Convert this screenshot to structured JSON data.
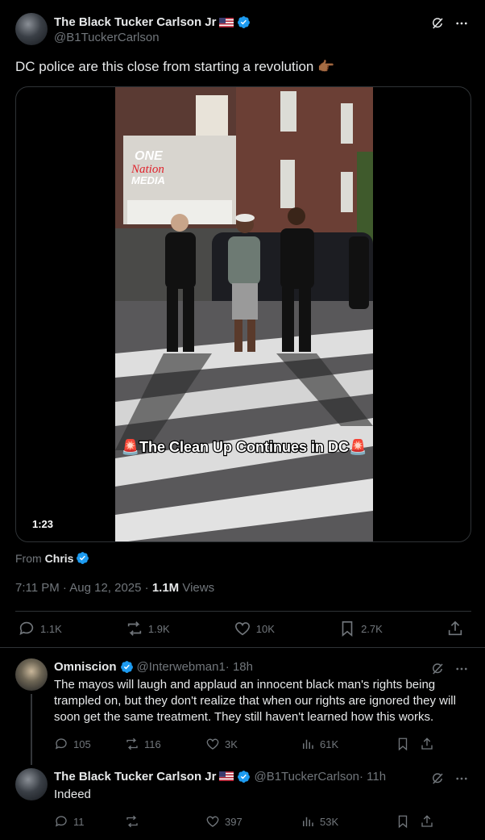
{
  "main_tweet": {
    "author_name": "The Black Tucker Carlson Jr",
    "handle": "@B1TuckerCarlson",
    "text": "DC police are this close from starting a revolution 👉🏾",
    "video_caption": "🚨The Clean Up Continues in DC🚨",
    "video_watermark": [
      "ONE",
      "Nation",
      "MEDIA"
    ],
    "duration": "1:23",
    "from_label": "From",
    "from_name": "Chris",
    "time": "7:11 PM · Aug 12, 2025 · ",
    "views_count": "1.1M",
    "views_label": " Views",
    "stats": {
      "replies": "1.1K",
      "reposts": "1.9K",
      "likes": "10K",
      "bookmarks": "2.7K"
    }
  },
  "replies": [
    {
      "author_name": "Omniscion",
      "handle": "@Interwebman1",
      "age": " · 18h",
      "text": "The mayos will laugh and applaud an innocent black man's rights being trampled on, but they don't realize that when our rights are ignored they will soon get the same treatment. They still haven't learned how this works.",
      "replies": "105",
      "reposts": "116",
      "likes": "3K",
      "views": "61K"
    },
    {
      "author_name": "The Black Tucker Carlson Jr",
      "handle": "@B1TuckerCarlson",
      "age": " · 11h",
      "text": "Indeed",
      "replies": "11",
      "reposts": "",
      "likes": "397",
      "views": "53K"
    }
  ],
  "colors": {
    "background": "#000000",
    "text": "#e7e9ea",
    "muted": "#71767b",
    "verified": "#1d9bf0",
    "border": "#2f3336"
  }
}
